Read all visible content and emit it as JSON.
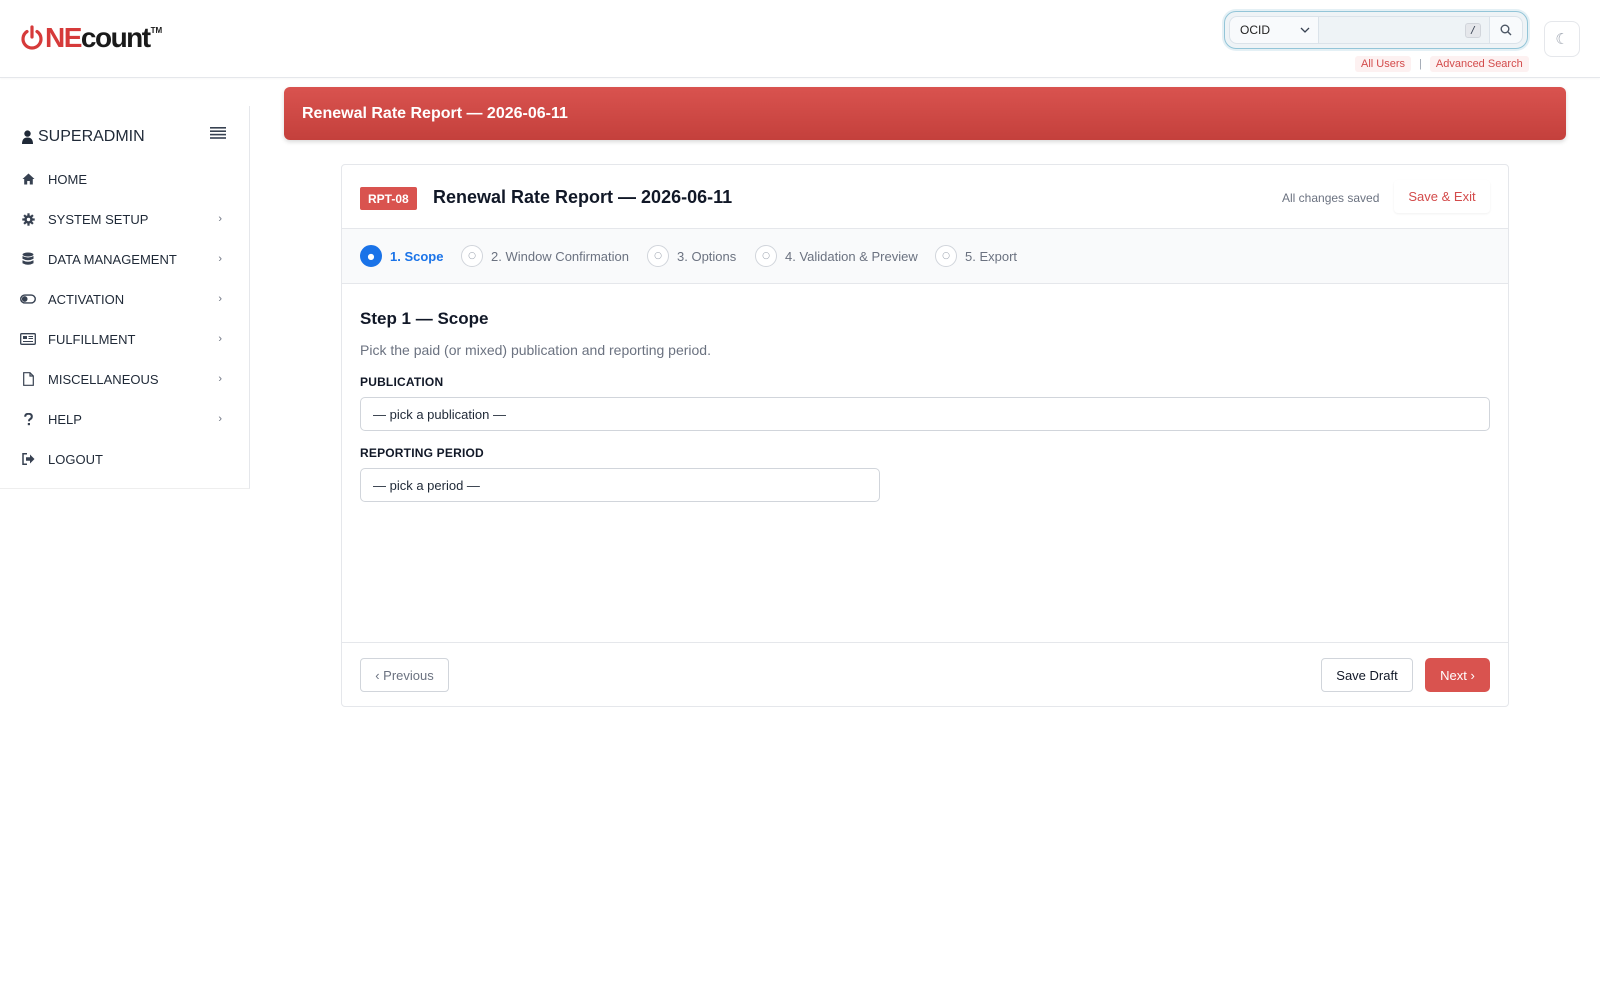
{
  "brand": {
    "logo_ne": "NE",
    "logo_count": "count",
    "logo_tm": "TM"
  },
  "search": {
    "type_value": "OCID",
    "input_value": "",
    "shortcut_key": "/",
    "links": [
      "All Users",
      "Advanced Search"
    ],
    "separator": "|"
  },
  "theme_toggle": {
    "icon": "moon-icon",
    "glyph": "☾"
  },
  "sidebar": {
    "user_label": "SUPERADMIN",
    "items": [
      {
        "label": "HOME",
        "icon": "home-icon",
        "has_submenu": false
      },
      {
        "label": "SYSTEM SETUP",
        "icon": "gear-icon",
        "has_submenu": true
      },
      {
        "label": "DATA MANAGEMENT",
        "icon": "database-icon",
        "has_submenu": true
      },
      {
        "label": "ACTIVATION",
        "icon": "toggle-icon",
        "has_submenu": true
      },
      {
        "label": "FULFILLMENT",
        "icon": "newspaper-icon",
        "has_submenu": true
      },
      {
        "label": "MISCELLANEOUS",
        "icon": "file-icon",
        "has_submenu": true
      },
      {
        "label": "HELP",
        "icon": "question-icon",
        "has_submenu": true
      },
      {
        "label": "LOGOUT",
        "icon": "sign-out-icon",
        "has_submenu": false
      }
    ],
    "chevron": "›"
  },
  "banner": {
    "title": "Renewal Rate Report — 2026-06-11"
  },
  "wizard": {
    "badge": "RPT-08",
    "title": "Renewal Rate Report — 2026-06-11",
    "save_status": "All changes saved",
    "save_exit_label": "Save & Exit",
    "steps": [
      {
        "label": "1. Scope",
        "state": "active",
        "marker": "●"
      },
      {
        "label": "2. Window Confirmation",
        "state": "pending",
        "marker": "○"
      },
      {
        "label": "3. Options",
        "state": "pending",
        "marker": "○"
      },
      {
        "label": "4. Validation & Preview",
        "state": "pending",
        "marker": "○"
      },
      {
        "label": "5. Export",
        "state": "pending",
        "marker": "○"
      }
    ],
    "step_heading": "Step 1 — Scope",
    "step_description": "Pick the paid (or mixed) publication and reporting period.",
    "fields": {
      "publication": {
        "label": "PUBLICATION",
        "value": "— pick a publication —"
      },
      "period": {
        "label": "REPORTING PERIOD",
        "value": "— pick a period —"
      }
    },
    "footer": {
      "previous_label": "‹ Previous",
      "save_draft_label": "Save Draft",
      "next_label": "Next ›"
    }
  },
  "colors": {
    "brand_red": "#d9534f",
    "active_blue": "#1a73e8",
    "link_red": "#d34b4b"
  }
}
